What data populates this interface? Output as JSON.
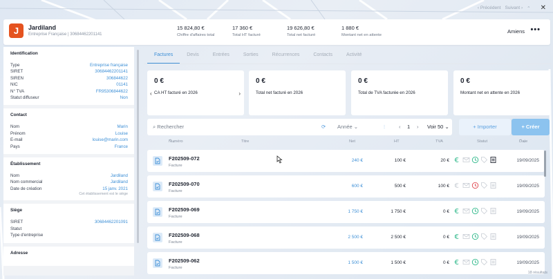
{
  "nav": {
    "prev": "Précédent",
    "next": "Suivant"
  },
  "company": {
    "logo_letter": "J",
    "name": "Jardiland",
    "subtitle": "Entreprise Française | 30684462201141"
  },
  "kpis": [
    {
      "value": "15 824,80 €",
      "label": "Chiffre d'affaires total"
    },
    {
      "value": "17 360 €",
      "label": "Total HT facturé"
    },
    {
      "value": "19 626,80 €",
      "label": "Total net facturé"
    },
    {
      "value": "1 880 €",
      "label": "Montant net en attente"
    }
  ],
  "city": "Amiens",
  "identification": {
    "title": "Identification",
    "rows": [
      {
        "k": "Type",
        "v": "Entreprise française"
      },
      {
        "k": "SIRET",
        "v": "30684462201141"
      },
      {
        "k": "SIREN",
        "v": "306844622"
      },
      {
        "k": "NIC",
        "v": "01141"
      },
      {
        "k": "N° TVA",
        "v": "FR95306844622"
      },
      {
        "k": "Statut diffuseur",
        "v": "Non"
      }
    ]
  },
  "contact": {
    "title": "Contact",
    "rows": [
      {
        "k": "Nom",
        "v": "Marin"
      },
      {
        "k": "Prénom",
        "v": "Louise"
      },
      {
        "k": "E-mail",
        "v": "louise@marin.com"
      },
      {
        "k": "Pays",
        "v": "France"
      }
    ]
  },
  "etablissement": {
    "title": "Établissement",
    "rows": [
      {
        "k": "Nom",
        "v": "Jardiland"
      },
      {
        "k": "Nom commercial",
        "v": "Jardiland"
      },
      {
        "k": "Date de création",
        "v": "15 janv. 2021"
      }
    ],
    "note": "Cet établissement est le siège"
  },
  "siege": {
    "title": "Siège",
    "rows": [
      {
        "k": "SIRET",
        "v": "30684462201091"
      },
      {
        "k": "Statut",
        "v": ""
      },
      {
        "k": "Type d'entreprise",
        "v": ""
      }
    ]
  },
  "adresse": {
    "title": "Adresse"
  },
  "tabs": [
    "Factures",
    "Devis",
    "Entrées",
    "Sorties",
    "Récurrences",
    "Contacts",
    "Activité"
  ],
  "stats": [
    {
      "value": "0 €",
      "label": "CA HT facturé en 2026"
    },
    {
      "value": "0 €",
      "label": "Total net facturé en 2026"
    },
    {
      "value": "0 €",
      "label": "Total de TVA facturée en 2026"
    },
    {
      "value": "0 €",
      "label": "Montant net en attente en 2026"
    }
  ],
  "toolbar": {
    "search_placeholder": "Rechercher",
    "year": "Année",
    "page": "1",
    "per_page": "Voir 50",
    "import_label": "Importer",
    "create_label": "Créer"
  },
  "table_headers": {
    "numero": "Numéro",
    "titre": "Titre",
    "net": "Net",
    "ht": "HT",
    "tva": "TVA",
    "statut": "Statut",
    "date": "Date"
  },
  "invoices": [
    {
      "numero": "F202509-072",
      "type": "Facture",
      "net": "240 €",
      "ht": "100 €",
      "tva": "20 €",
      "date": "19/09/2025"
    },
    {
      "numero": "F202509-070",
      "type": "Facture",
      "net": "600 €",
      "ht": "500 €",
      "tva": "100 €",
      "date": "19/09/2025"
    },
    {
      "numero": "F202509-069",
      "type": "Facture",
      "net": "1 750 €",
      "ht": "1 750 €",
      "tva": "0 €",
      "date": "19/09/2025"
    },
    {
      "numero": "F202509-068",
      "type": "Facture",
      "net": "2 500 €",
      "ht": "2 500 €",
      "tva": "0 €",
      "date": "19/09/2025"
    },
    {
      "numero": "F202509-062",
      "type": "Facture",
      "net": "1 500 €",
      "ht": "1 500 €",
      "tva": "0 €",
      "date": "19/09/2025"
    }
  ],
  "results": "18 résultats",
  "colors": {
    "accent": "#3d8fd6",
    "logo": "#e5531f",
    "green": "#2eb88a",
    "red": "#e0484f"
  }
}
